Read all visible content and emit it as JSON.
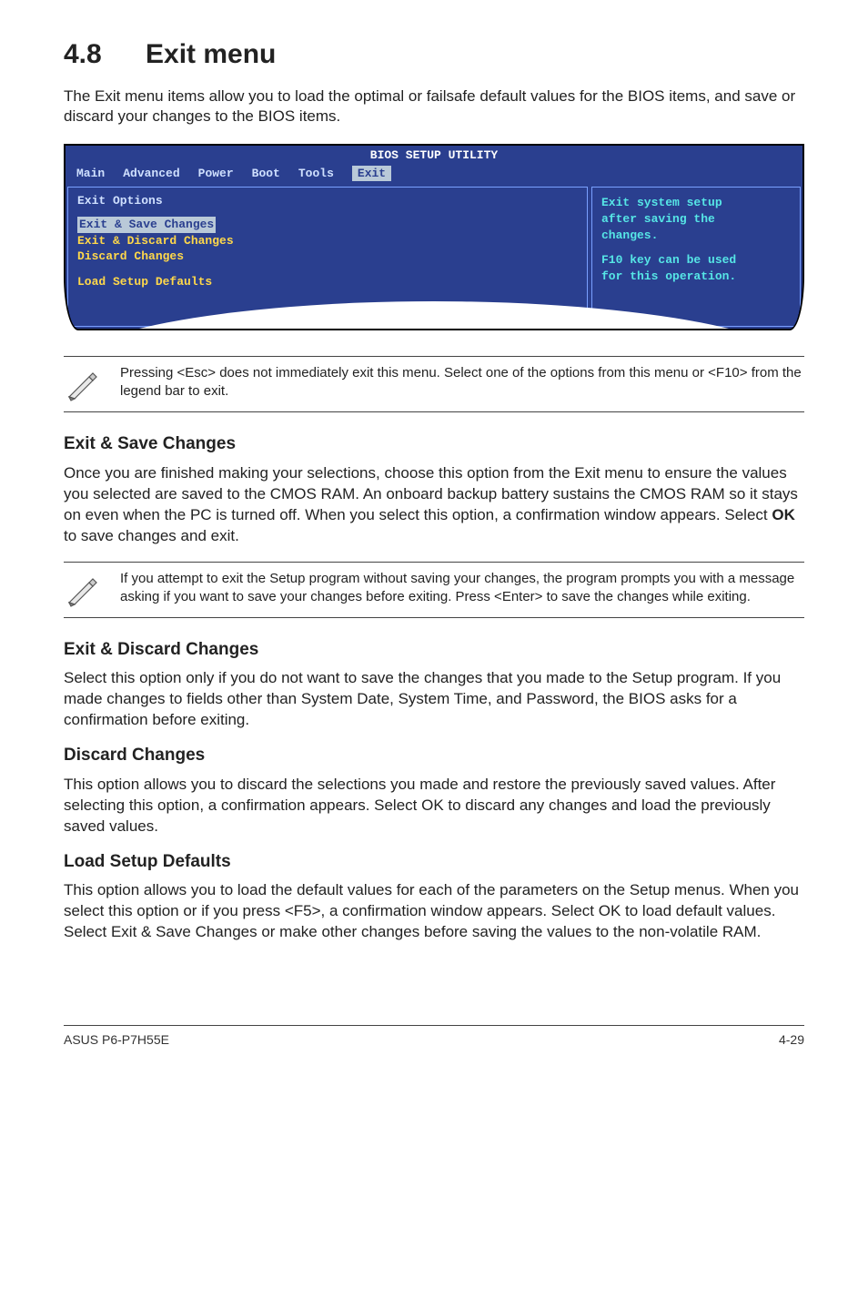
{
  "title_num": "4.8",
  "title_text": "Exit menu",
  "intro": "The Exit menu items allow you to load the optimal or failsafe default values for the BIOS items, and save or discard your changes to the BIOS items.",
  "bios": {
    "top": "BIOS SETUP UTILITY",
    "tabs": {
      "t0": "Main",
      "t1": "Advanced",
      "t2": "Power",
      "t3": "Boot",
      "t4": "Tools",
      "t5": "Exit"
    },
    "left_heading": "Exit Options",
    "left_items": {
      "i0": "Exit & Save Changes",
      "i1": "Exit & Discard Changes",
      "i2": "Discard Changes",
      "i3": "Load Setup Defaults"
    },
    "right_l0": "Exit system setup",
    "right_l1": "after saving the",
    "right_l2": "changes.",
    "right_l3": "F10 key can be used",
    "right_l4": "for this operation."
  },
  "note1": "Pressing <Esc> does not immediately exit this menu. Select one of the options from this menu or <F10> from the legend bar to exit.",
  "sec1_h": "Exit & Save Changes",
  "sec1_p_a": "Once you are finished making your selections, choose this option from the Exit menu to ensure the values you selected are saved to the CMOS RAM. An onboard backup battery sustains the CMOS RAM so it stays on even when the PC is turned off. When you select this option, a confirmation window appears. Select ",
  "sec1_p_ok": "OK",
  "sec1_p_b": " to save changes and exit.",
  "note2": " If you attempt to exit the Setup program without saving your changes, the program prompts you with a message asking if you want to save your changes before exiting. Press <Enter>  to save the  changes while exiting.",
  "sec2_h": "Exit & Discard Changes",
  "sec2_p": "Select this option only if you do not want to save the changes that you  made to the Setup program. If you made changes to fields other than System Date, System Time, and Password, the BIOS asks for a confirmation before exiting.",
  "sec3_h": "Discard Changes",
  "sec3_p": "This option allows you to discard the selections you made and restore the previously saved values. After selecting this option, a confirmation appears. Select OK to discard any changes and load the previously saved values.",
  "sec4_h": "Load Setup Defaults",
  "sec4_p": "This option allows you to load the default values for each of the parameters on the Setup menus. When you select this option or if you press <F5>, a confirmation window appears. Select OK to load default values. Select Exit & Save Changes or make other changes before saving the values to the non-volatile RAM.",
  "footer_left": "ASUS P6-P7H55E",
  "footer_right": "4-29"
}
